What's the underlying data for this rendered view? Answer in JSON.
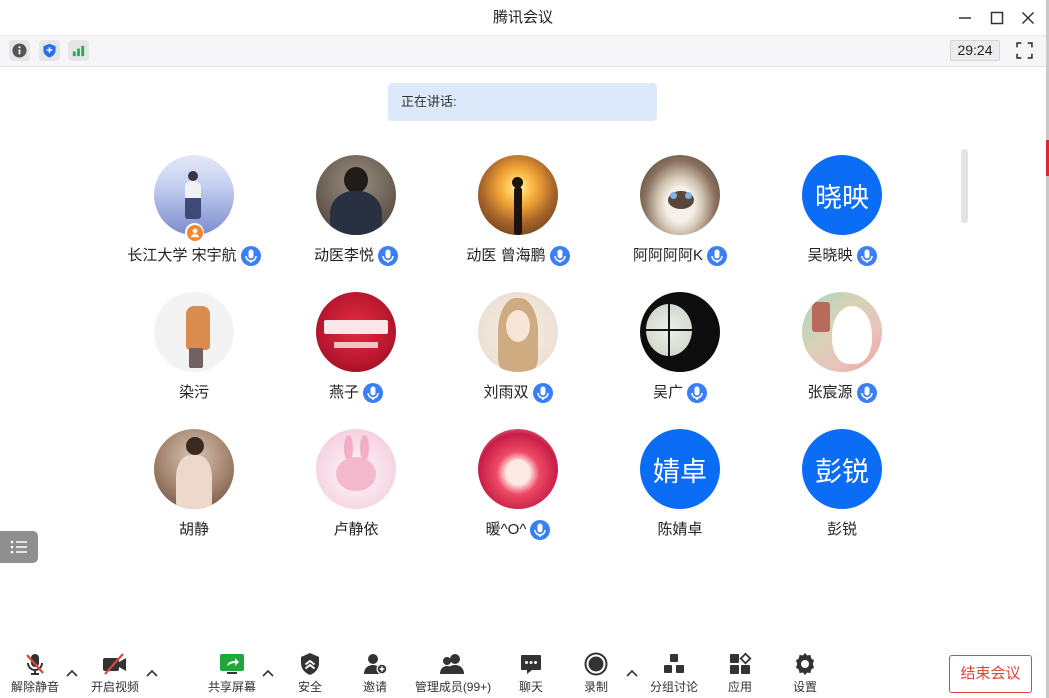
{
  "window": {
    "title": "腾讯会议",
    "controls": [
      "minimize-icon",
      "maximize-icon",
      "close-icon"
    ]
  },
  "status_bar": {
    "icons": [
      "info-icon",
      "shield-icon",
      "signal-icon"
    ],
    "timer": "29:24",
    "fullscreen_icon": "fullscreen-icon"
  },
  "speaking": {
    "label": "正在讲话:"
  },
  "participants": [
    {
      "name": "长江大学 宋宇航",
      "mic": true,
      "host": true
    },
    {
      "name": "动医李悦",
      "mic": true
    },
    {
      "name": "动医 曾海鹏",
      "mic": true
    },
    {
      "name": "阿阿阿阿K",
      "mic": true
    },
    {
      "name": "吴晓映",
      "mic": true,
      "avatar_text": "晓映"
    },
    {
      "name": "染污",
      "mic": false
    },
    {
      "name": "燕子",
      "mic": true
    },
    {
      "name": "刘雨双",
      "mic": true
    },
    {
      "name": "吴广",
      "mic": true
    },
    {
      "name": "张宸源",
      "mic": true
    },
    {
      "name": "胡静",
      "mic": false
    },
    {
      "name": "卢静依",
      "mic": false
    },
    {
      "name": "暖^O^",
      "mic": true
    },
    {
      "name": "陈婧卓",
      "mic": false,
      "avatar_text": "婧卓"
    },
    {
      "name": "彭锐",
      "mic": false,
      "avatar_text": "彭锐"
    }
  ],
  "side_button_icon": "list-icon",
  "toolbar": {
    "items": [
      {
        "label": "解除静音",
        "icon": "mic-muted-icon"
      },
      {
        "label": "开启视频",
        "icon": "video-off-icon"
      },
      {
        "label": "共享屏幕",
        "icon": "share-screen-icon"
      },
      {
        "label": "安全",
        "icon": "security-shield-icon"
      },
      {
        "label": "邀请",
        "icon": "invite-user-icon"
      },
      {
        "label": "管理成员(99+)",
        "icon": "members-icon"
      },
      {
        "label": "聊天",
        "icon": "chat-icon"
      },
      {
        "label": "录制",
        "icon": "record-icon"
      },
      {
        "label": "分组讨论",
        "icon": "breakout-icon"
      },
      {
        "label": "应用",
        "icon": "apps-icon"
      },
      {
        "label": "设置",
        "icon": "gear-icon"
      }
    ],
    "end_meeting": "结束会议"
  },
  "colors": {
    "accent": "#0b6cf6",
    "danger": "#e0443a",
    "share_green": "#1ea838",
    "host_badge": "#f5862a",
    "speaking_bg": "#dce9fb",
    "signal_green": "#21b04b"
  }
}
